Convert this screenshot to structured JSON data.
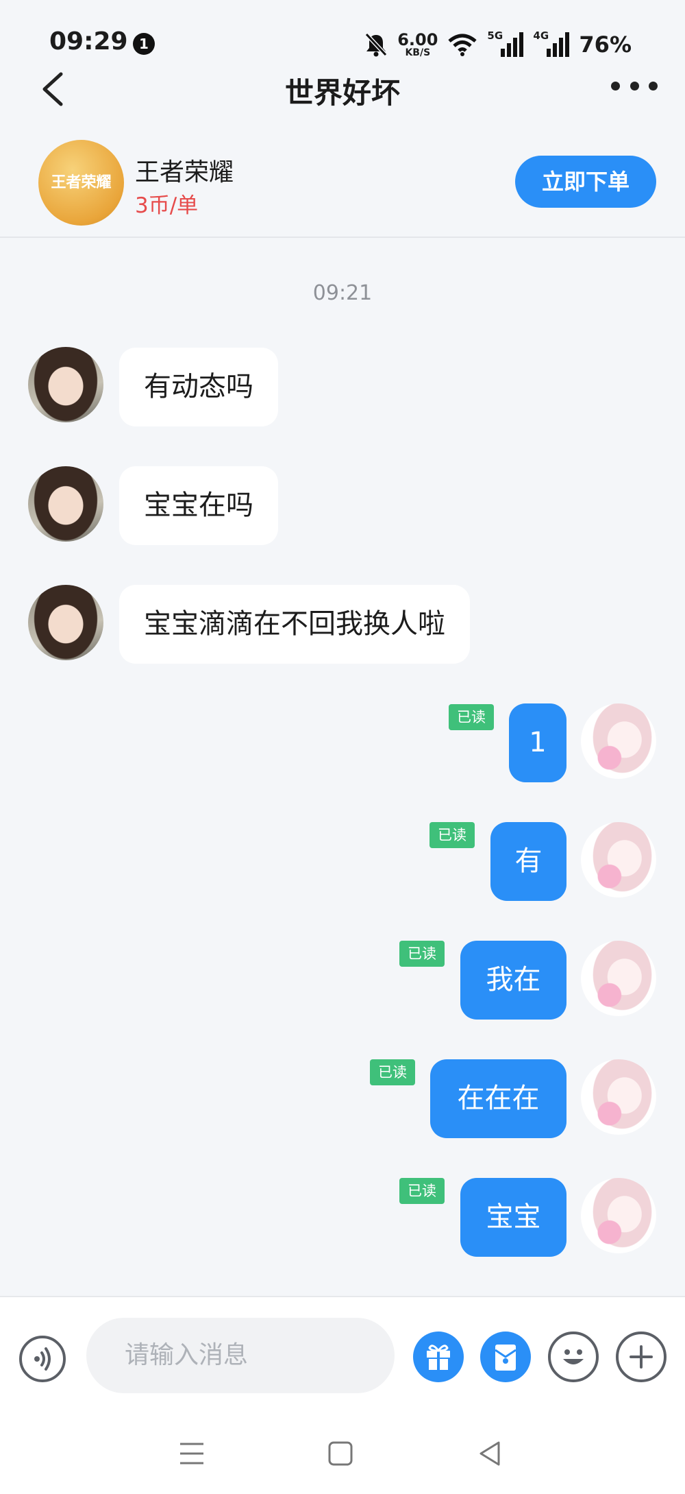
{
  "status_bar": {
    "time": "09:29",
    "notification_count": "1",
    "net_speed_value": "6.00",
    "net_speed_unit": "KB/S",
    "sim1_tag": "5G",
    "sim2_tag": "4G",
    "battery": "76%"
  },
  "header": {
    "title": "世界好坏",
    "back_icon": "chevron-left-icon",
    "more_icon": "more-horizontal-icon"
  },
  "product": {
    "logo_text": "王者荣耀",
    "name": "王者荣耀",
    "price": "3币/单",
    "order_button": "立即下单"
  },
  "chat": {
    "timestamp": "09:21",
    "read_label": "已读",
    "incoming": [
      {
        "text": "有动态吗"
      },
      {
        "text": "宝宝在吗"
      },
      {
        "text": "宝宝滴滴在不回我换人啦"
      }
    ],
    "outgoing": [
      {
        "text": "1"
      },
      {
        "text": "有"
      },
      {
        "text": "我在"
      },
      {
        "text": "在在在"
      },
      {
        "text": "宝宝"
      }
    ]
  },
  "input_bar": {
    "placeholder": "请输入消息",
    "icons": [
      "voice-icon",
      "gift-icon",
      "coupon-icon",
      "emoji-icon",
      "plus-icon"
    ]
  },
  "nav_bar": {
    "icons": [
      "menu-icon",
      "home-square-icon",
      "back-triangle-icon"
    ]
  },
  "colors": {
    "accent": "#2a8ff7",
    "read_tag": "#3fc07a",
    "price": "#e64b4b",
    "background": "#f4f6f9"
  }
}
